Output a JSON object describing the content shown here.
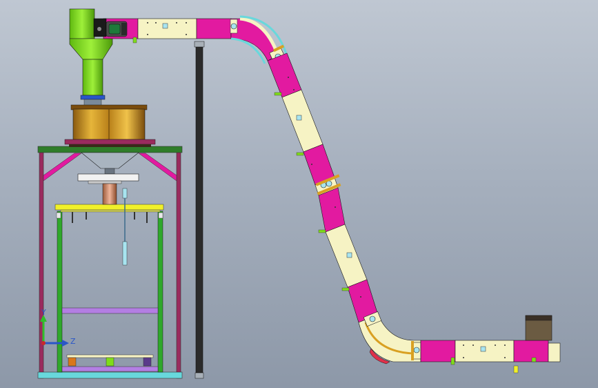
{
  "viewport": {
    "background_top": "#bfc7d2",
    "background_bottom": "#8d98a8"
  },
  "colors": {
    "pink": "#e21aa0",
    "cream": "#f6f3c4",
    "green": "#7fdc1a",
    "gold": "#d9a022",
    "frame_green": "#2fa82b",
    "frame_purple": "#9a2b5e",
    "yellow_bar": "#f0f02a",
    "cyan": "#68d8dc",
    "dark_pole": "#2b2b2b",
    "bracket": "#b37ee3",
    "feeder_box": "#6b5b42"
  },
  "icons": {
    "motor": "electric-motor-icon",
    "triad": "xyz-axis-triad-icon"
  },
  "triad": {
    "y_label": "Y",
    "z_label": "Z"
  }
}
